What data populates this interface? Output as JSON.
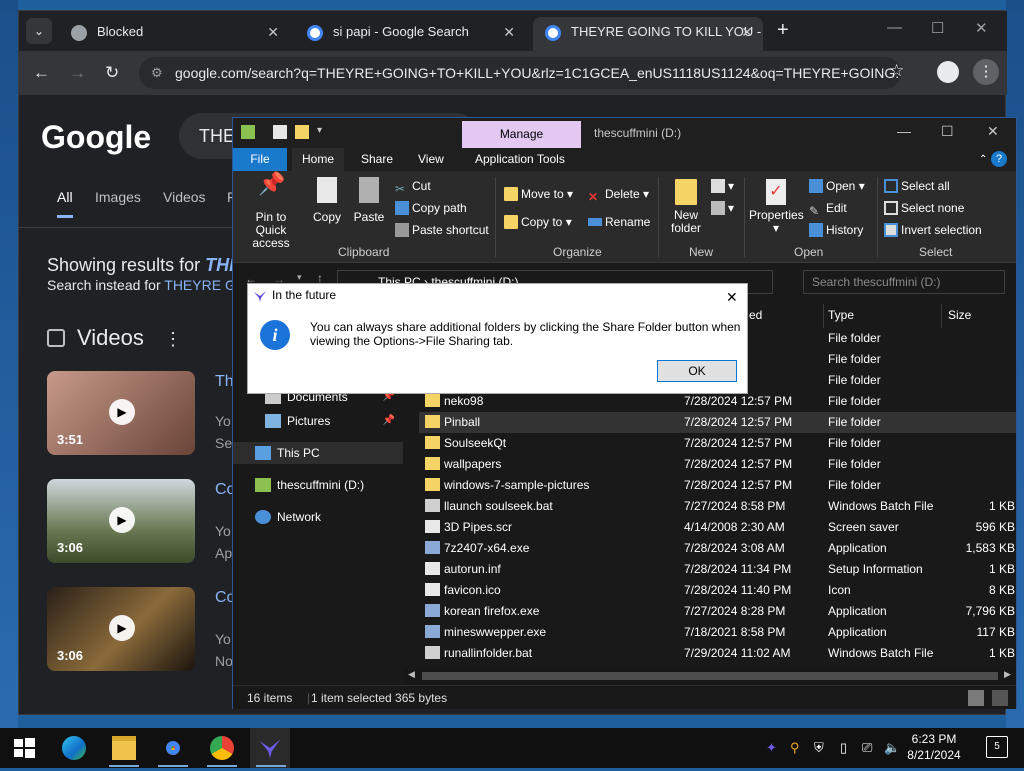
{
  "chrome": {
    "tabs": [
      {
        "title": "Blocked",
        "close": "✕"
      },
      {
        "title": "si papi - Google Search",
        "close": "✕"
      },
      {
        "title": "THEYRE GOING TO KILL YOU - G",
        "close": "✕"
      }
    ],
    "new_tab": "+",
    "url": "google.com/search?q=THEYRE+GOING+TO+KILL+YOU&rlz=1C1GCEA_enUS1118US1124&oq=THEYRE+GOING..."
  },
  "google": {
    "logo": "Google",
    "search_value": "THE",
    "tabs": [
      "All",
      "Images",
      "Videos",
      "F"
    ],
    "showing_prefix": "Showing results for ",
    "showing_term": "THI",
    "instead_prefix": "Search instead for ",
    "instead_term": "THEYRE G",
    "videos_heading": "Videos",
    "videos": [
      {
        "duration": "3:51",
        "title": "Th",
        "sub1": "Yo",
        "sub2": "Se"
      },
      {
        "duration": "3:06",
        "title": "Co",
        "sub1": "Yo",
        "sub2": "Ap"
      },
      {
        "duration": "3:06",
        "title": "Co",
        "sub1": "Yo",
        "sub2": "No"
      }
    ]
  },
  "explorer": {
    "manage_label": "Manage",
    "title": "thescuffmini (D:)",
    "ribbon_tabs": [
      "File",
      "Home",
      "Share",
      "View",
      "Application Tools"
    ],
    "clipboard": {
      "pin": "Pin to Quick access",
      "copy": "Copy",
      "paste": "Paste",
      "cut": "Cut",
      "copy_path": "Copy path",
      "paste_shortcut": "Paste shortcut",
      "group": "Clipboard"
    },
    "organize": {
      "move_to": "Move to",
      "copy_to": "Copy to",
      "delete": "Delete",
      "rename": "Rename",
      "group": "Organize"
    },
    "new": {
      "new_folder": "New folder",
      "group": "New"
    },
    "open": {
      "properties": "Properties",
      "open": "Open",
      "edit": "Edit",
      "history": "History",
      "group": "Open"
    },
    "select": {
      "select_all": "Select all",
      "select_none": "Select none",
      "invert": "Invert selection",
      "group": "Select"
    },
    "address": "This PC  ›  thescuffmini (D:)",
    "search_placeholder": "Search thescuffmini (D:)",
    "columns": {
      "modified": "ed",
      "type": "Type",
      "size": "Size"
    },
    "nav": [
      {
        "label": "Documents",
        "pinned": true
      },
      {
        "label": "Pictures",
        "pinned": true
      },
      {
        "label": "This PC",
        "pinned": false
      },
      {
        "label": "thescuffmini (D:)",
        "pinned": false
      },
      {
        "label": "Network",
        "pinned": false
      }
    ],
    "rows": [
      {
        "name": "",
        "date": "12:57 PM",
        "type": "File folder",
        "size": "",
        "kind": "folder"
      },
      {
        "name": "",
        "date": "12:57 PM",
        "type": "File folder",
        "size": "",
        "kind": "folder"
      },
      {
        "name": "",
        "date": "12:57 PM",
        "type": "File folder",
        "size": "",
        "kind": "folder"
      },
      {
        "name": "neko98",
        "date": "7/28/2024 12:57 PM",
        "type": "File folder",
        "size": "",
        "kind": "folder"
      },
      {
        "name": "Pinball",
        "date": "7/28/2024 12:57 PM",
        "type": "File folder",
        "size": "",
        "kind": "folder"
      },
      {
        "name": "SoulseekQt",
        "date": "7/28/2024 12:57 PM",
        "type": "File folder",
        "size": "",
        "kind": "folder"
      },
      {
        "name": "wallpapers",
        "date": "7/28/2024 12:57 PM",
        "type": "File folder",
        "size": "",
        "kind": "folder"
      },
      {
        "name": "windows-7-sample-pictures",
        "date": "7/28/2024 12:57 PM",
        "type": "File folder",
        "size": "",
        "kind": "folder"
      },
      {
        "name": "llaunch soulseek.bat",
        "date": "7/27/2024 8:58 PM",
        "type": "Windows Batch File",
        "size": "1 KB",
        "kind": "bat"
      },
      {
        "name": "3D Pipes.scr",
        "date": "4/14/2008 2:30 AM",
        "type": "Screen saver",
        "size": "596 KB",
        "kind": "file"
      },
      {
        "name": "7z2407-x64.exe",
        "date": "7/28/2024 3:08 AM",
        "type": "Application",
        "size": "1,583 KB",
        "kind": "exe"
      },
      {
        "name": "autorun.inf",
        "date": "7/28/2024 11:34 PM",
        "type": "Setup Information",
        "size": "1 KB",
        "kind": "file"
      },
      {
        "name": "favicon.ico",
        "date": "7/28/2024 11:40 PM",
        "type": "Icon",
        "size": "8 KB",
        "kind": "file"
      },
      {
        "name": "korean firefox.exe",
        "date": "7/27/2024 8:28 PM",
        "type": "Application",
        "size": "7,796 KB",
        "kind": "exe"
      },
      {
        "name": "mineswwepper.exe",
        "date": "7/18/2021 8:58 PM",
        "type": "Application",
        "size": "117 KB",
        "kind": "exe"
      },
      {
        "name": "runallinfolder.bat",
        "date": "7/29/2024 11:02 AM",
        "type": "Windows Batch File",
        "size": "1 KB",
        "kind": "bat"
      }
    ],
    "status_count": "16 items",
    "status_selected": "1 item selected  365 bytes"
  },
  "dialog": {
    "title": "In the future",
    "message": "You can always share additional folders by clicking the Share Folder button when viewing the Options->File Sharing tab.",
    "ok": "OK"
  },
  "taskbar": {
    "time": "6:23 PM",
    "date": "8/21/2024",
    "notifications": "5"
  },
  "colors": {
    "accent": "#1979ca",
    "manage": "#e3c9f2",
    "link": "#8ab4f8"
  }
}
